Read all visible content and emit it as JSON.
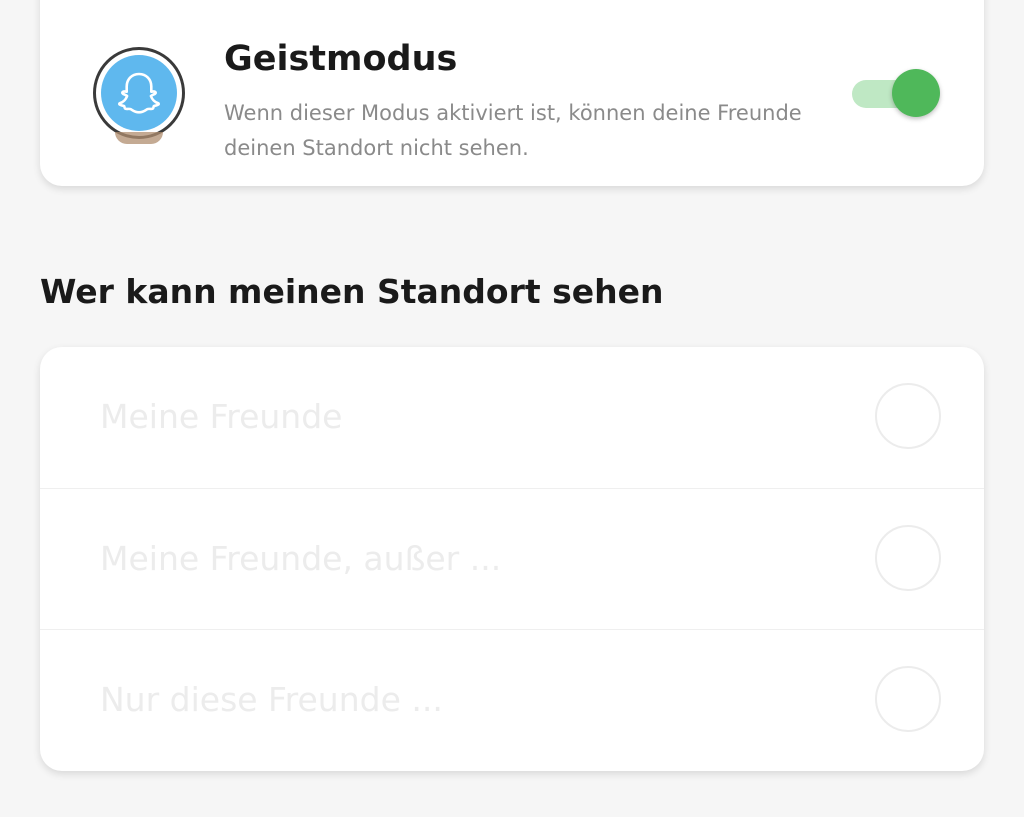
{
  "ghost_mode": {
    "title": "Geistmodus",
    "description": "Wenn dieser Modus aktiviert ist, können deine Freunde deinen Standort nicht sehen.",
    "toggle_on": true,
    "toggle_color": "#4fb85a",
    "avatar_icon": "snapchat-ghost-icon",
    "avatar_color": "#5fb8ee"
  },
  "visibility": {
    "heading": "Wer kann meinen Standort sehen",
    "options": [
      {
        "label": "Meine Freunde",
        "selected": false
      },
      {
        "label": "Meine Freunde, außer ...",
        "selected": false
      },
      {
        "label": "Nur diese Freunde ...",
        "selected": false
      }
    ]
  }
}
